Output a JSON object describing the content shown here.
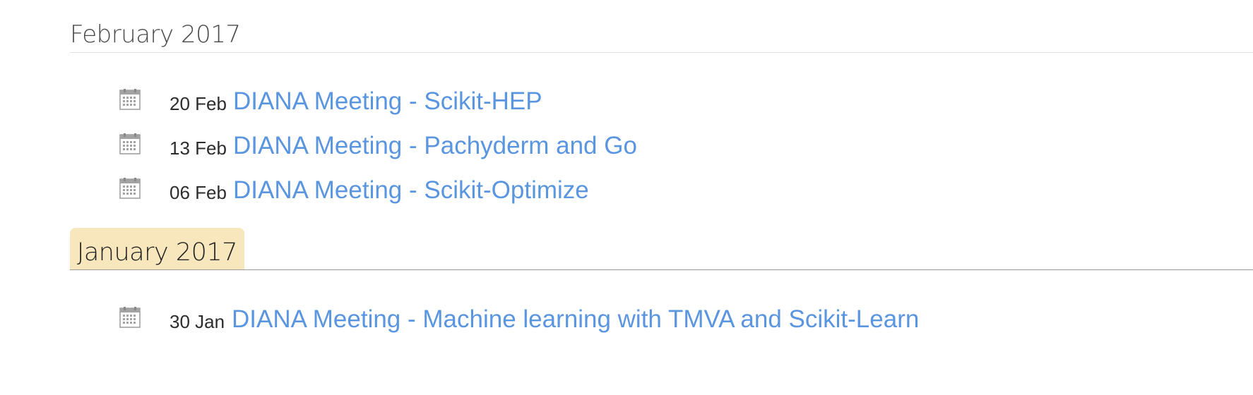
{
  "months": [
    {
      "title": "February 2017",
      "highlighted": false,
      "events": [
        {
          "date": "20 Feb",
          "title": "DIANA Meeting - Scikit-HEP",
          "icon": "calendar-icon"
        },
        {
          "date": "13 Feb",
          "title": "DIANA Meeting - Pachyderm and Go",
          "icon": "calendar-icon"
        },
        {
          "date": "06 Feb",
          "title": "DIANA Meeting - Scikit-Optimize",
          "icon": "calendar-icon"
        }
      ]
    },
    {
      "title": "January 2017",
      "highlighted": true,
      "events": [
        {
          "date": "30 Jan",
          "title": "DIANA Meeting - Machine learning with TMVA and Scikit-Learn",
          "icon": "calendar-icon"
        }
      ]
    }
  ],
  "colors": {
    "link": "#5a95e0",
    "highlight": "#f8e6bd",
    "icon": "#9a9a9a"
  }
}
